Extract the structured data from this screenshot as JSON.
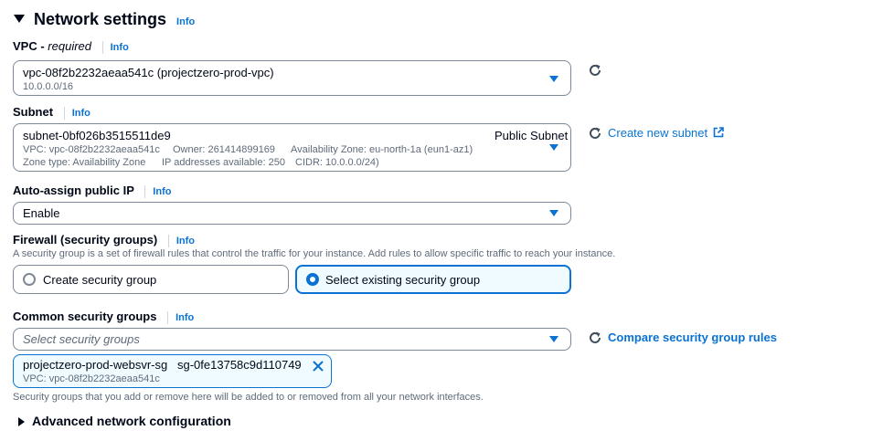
{
  "section": {
    "title": "Network settings",
    "info": "Info"
  },
  "vpc": {
    "label": "VPC - ",
    "required": "required",
    "info": "Info",
    "value": "vpc-08f2b2232aeaa541c (projectzero-prod-vpc)",
    "cidr": "10.0.0.0/16"
  },
  "subnet": {
    "label": "Subnet",
    "info": "Info",
    "value": "subnet-0bf026b3515511de9",
    "tag": "Public Subnet",
    "detail_vpc": "VPC: vpc-08f2b2232aeaa541c",
    "detail_owner": "Owner: 261414899169",
    "detail_az": "Availability Zone: eu-north-1a (eun1-az1)",
    "detail_zone_type": "Zone type: Availability Zone",
    "detail_ips": "IP addresses available: 250",
    "detail_cidr": "CIDR: 10.0.0.0/24)",
    "create_link": "Create new subnet"
  },
  "auto_assign": {
    "label": "Auto-assign public IP",
    "info": "Info",
    "value": "Enable"
  },
  "firewall": {
    "label": "Firewall (security groups)",
    "info": "Info",
    "description": "A security group is a set of firewall rules that control the traffic for your instance. Add rules to allow specific traffic to reach your instance.",
    "options": [
      {
        "label": "Create security group",
        "selected": false
      },
      {
        "label": "Select existing security group",
        "selected": true
      }
    ]
  },
  "common_sg": {
    "label": "Common security groups",
    "info": "Info",
    "placeholder": "Select security groups",
    "compare_link": "Compare security group rules",
    "token": {
      "name": "projectzero-prod-websvr-sg",
      "id": "sg-0fe13758c9d110749",
      "vpc": "VPC: vpc-08f2b2232aeaa541c"
    },
    "hint": "Security groups that you add or remove here will be added to or removed from all your network interfaces."
  },
  "advanced": {
    "label": "Advanced network configuration"
  },
  "colors": {
    "accent": "#0972d3",
    "text": "#000716",
    "muted": "#5f6b7a",
    "border": "#7d8998",
    "selected_bg": "#f0fbff"
  },
  "icons": [
    "caret-down-icon",
    "refresh-icon",
    "external-link-icon",
    "close-icon",
    "caret-right-icon"
  ]
}
